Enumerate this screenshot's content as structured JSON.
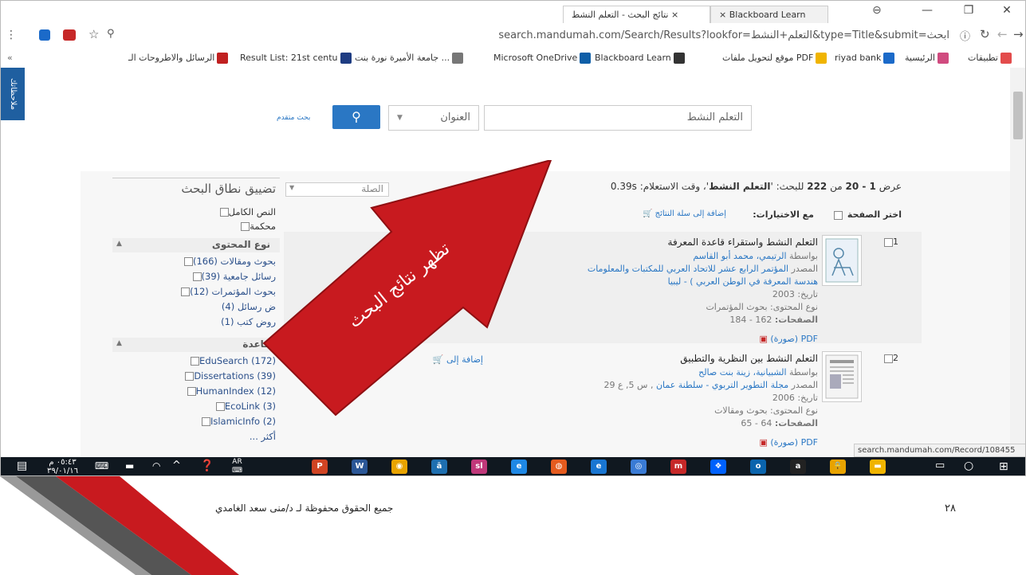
{
  "browser": {
    "tabs": [
      {
        "label": "نتائج البحث - التعلم النشط  ×"
      },
      {
        "label": "×  Blackboard Learn"
      }
    ],
    "window_buttons": [
      "—",
      "❐",
      "✕"
    ],
    "url": "search.mandumah.com/Search/Results?lookfor=التعلم+النشط&type=Title&submit=ابحث"
  },
  "bookmarks": [
    {
      "label": "تطبيقات",
      "color": "#e34c4c"
    },
    {
      "label": "الرئيسية",
      "color": "#d04b7f"
    },
    {
      "label": "riyad bank",
      "color": "#1b6ac9"
    },
    {
      "label": "موقع لتحويل ملفات PDF",
      "color": "#f0b400"
    },
    {
      "label": "Blackboard Learn",
      "color": "#333333"
    },
    {
      "label": "Microsoft OneDrive",
      "color": "#0f5fa8"
    },
    {
      "label": "جامعة الأميرة نورة بنت ...",
      "color": "#777777"
    },
    {
      "label": "Result List: 21st centu",
      "color": "#1e3c82"
    },
    {
      "label": "الرسائل والاطروحات الـ",
      "color": "#c02020"
    }
  ],
  "sidebar_tab": "ملاحظاتك",
  "search": {
    "query": "التعلم النشط",
    "field": "العنوان",
    "button_icon": "search-icon",
    "advanced": "بحث متقدم"
  },
  "results_header": {
    "summary_parts": [
      "عرض ",
      "1 - 20",
      " من ",
      "222",
      " للبحث: '",
      "التعلم النشط",
      "'، وقت الاستعلام: 0.39s"
    ],
    "sort_label": "الصلة",
    "select_page": "اختر الصفحة",
    "with_selected": "مع الاختيارات:",
    "add_to_cart": "إضافة إلى سلة النتائج"
  },
  "results": [
    {
      "num": "1",
      "title": "التعلم النشط واستقراء قاعدة المعرفة",
      "authors_prefix": "بواسطة ",
      "authors": "الرتيمي، محمد أبو القاسم",
      "source_prefix": "المصدر ",
      "source": "المؤتمر الرابع عشر للاتحاد العربي للمكتبات والمعلومات",
      "source2": "هندسة المعرفة في الوطن العربي ) - ليبيا",
      "date": "تاريخ: 2003",
      "type": "نوع المحتوى: بحوث المؤتمرات",
      "pages_label": "الصفحات:",
      "pages": " 162 - 184",
      "pdf": "PDF (صورة)"
    },
    {
      "num": "2",
      "title": "التعلم النشط بين النظرية والتطبيق",
      "authors_prefix": "بواسطة ",
      "authors": "الشبيانية، زينة بنت صالح",
      "source_prefix": "المصدر ",
      "source": "مجلة التطوير التربوي - سلطنة عمان",
      "source_tail": " , س 5, ع 29",
      "date": "تاريخ: 2006",
      "type": "نوع المحتوى: بحوث ومقالات",
      "pages_label": "الصفحات:",
      "pages": " 64 - 65",
      "pdf": "PDF (صورة)",
      "add_link": "إضافة إلى"
    }
  ],
  "facets": {
    "title": "تضييق نطاق البحث",
    "top": [
      "النص الكامل",
      "محكمة"
    ],
    "content_type_title": "نوع المحتوى",
    "content_types": [
      "بحوث ومقالات (166)",
      "رسائل جامعية (39)",
      "بحوث المؤتمرات (12)",
      "ض رسائل (4)",
      "روض كتب (1)"
    ],
    "database_title": "قاعدة",
    "databases": [
      "EduSearch (172)",
      "Dissertations (39)",
      "HumanIndex (12)",
      "EcoLink (3)",
      "IslamicInfo (2)"
    ],
    "more": "أكثر ..."
  },
  "status_url": "search.mandumah.com/Record/108455",
  "arrow_text": "تظهر نتائج البحث",
  "taskbar": {
    "time": "٠٥:٤٣ م",
    "date": "٣٩/٠١/١٦",
    "lang": "AR",
    "apps": [
      {
        "label": "P",
        "color": "#d04423"
      },
      {
        "label": "W",
        "color": "#2b5797"
      },
      {
        "label": "◉",
        "color": "#e8a300"
      },
      {
        "label": "ā",
        "color": "#1e6fb0"
      },
      {
        "label": "sl",
        "color": "#c0387a"
      },
      {
        "label": "e",
        "color": "#1e88e5"
      },
      {
        "label": "◍",
        "color": "#e55b1e"
      },
      {
        "label": "e",
        "color": "#1976d2"
      },
      {
        "label": "◎",
        "color": "#3a7bd5"
      },
      {
        "label": "m",
        "color": "#c62828"
      },
      {
        "label": "❖",
        "color": "#0061fe"
      },
      {
        "label": "o",
        "color": "#0a64ad"
      },
      {
        "label": "a",
        "color": "#222222"
      },
      {
        "label": "🔒",
        "color": "#e8a300"
      },
      {
        "label": "▬",
        "color": "#f0b400"
      }
    ]
  },
  "footer": {
    "credit": "جميع الحقوق محفوظة لـ د/منى سعد الغامدي",
    "slide_number": "٢٨"
  }
}
